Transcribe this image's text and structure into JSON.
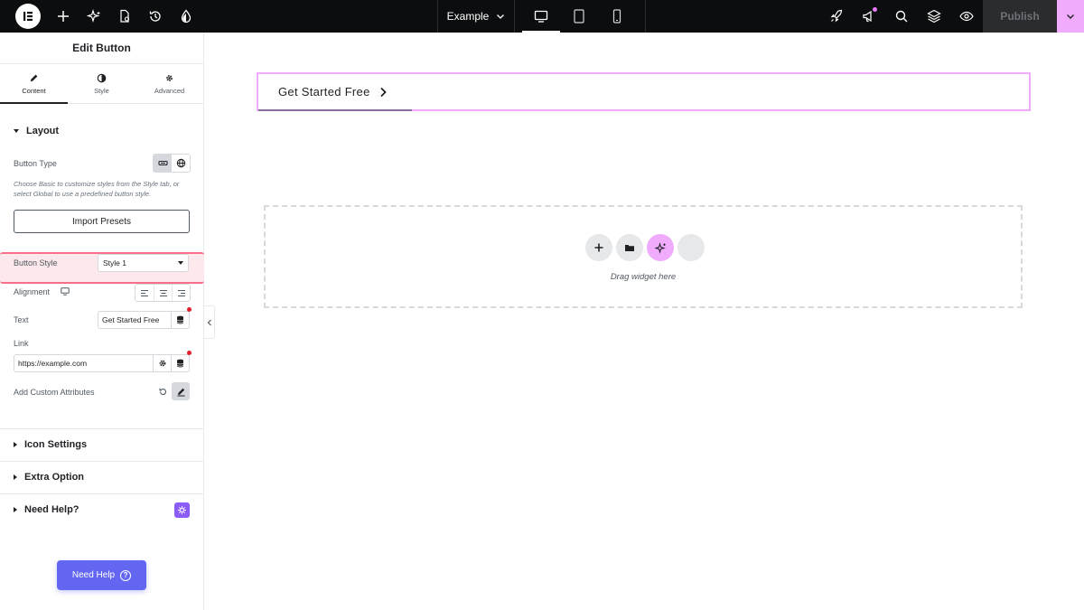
{
  "topbar": {
    "document_name": "Example",
    "publish_label": "Publish"
  },
  "panel": {
    "title": "Edit Button",
    "tabs": [
      {
        "label": "Content",
        "icon": "pencil-icon"
      },
      {
        "label": "Style",
        "icon": "half-circle-icon"
      },
      {
        "label": "Advanced",
        "icon": "gear-icon"
      }
    ],
    "layout": {
      "heading": "Layout",
      "button_type_label": "Button Type",
      "help_text": "Choose Basic to customize styles from the Style tab, or select Global to use a predefined button style.",
      "import_presets_label": "Import Presets",
      "button_style_label": "Button Style",
      "button_style_value": "Style 1",
      "alignment_label": "Alignment",
      "text_label": "Text",
      "text_value": "Get Started Free",
      "link_label": "Link",
      "link_value": "https://example.com",
      "custom_attributes_label": "Add Custom Attributes"
    },
    "sections": {
      "icon_settings": "Icon Settings",
      "extra_option": "Extra Option",
      "need_help": "Need Help?"
    },
    "need_help_button": "Need Help"
  },
  "canvas": {
    "button_text": "Get Started Free",
    "drop_text": "Drag widget here"
  },
  "colors": {
    "accent_pink": "#f0abfc",
    "highlight": "#f87189",
    "help_button": "#6366f1"
  }
}
